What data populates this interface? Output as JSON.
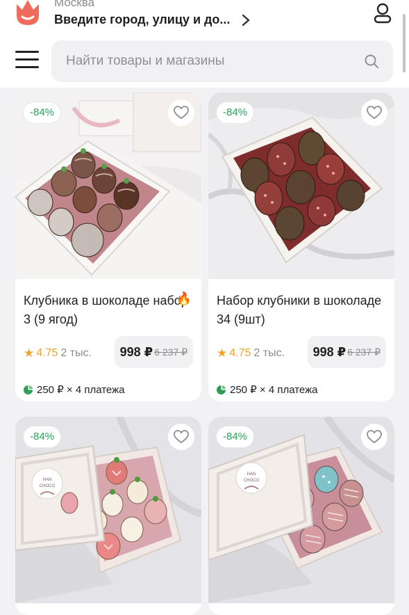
{
  "header": {
    "city": "Москва",
    "address_prompt": "Введите город, улицу и до...",
    "search_placeholder": "Найти товары и магазины"
  },
  "products": [
    {
      "discount": "-84%",
      "title": "Клубника в шоколаде набор 3 (9 ягод)",
      "hot_badge": "🔥",
      "rating": "4.75",
      "reviews": "2 тыс.",
      "price": "998 ₽",
      "old_price": "6 237 ₽",
      "installment": "250 ₽ × 4 платежа"
    },
    {
      "discount": "-84%",
      "title": "Набор клубники в шоколаде 34 (9шт)",
      "hot_badge": "",
      "rating": "4.75",
      "reviews": "2 тыс.",
      "price": "998 ₽",
      "old_price": "6 237 ₽",
      "installment": "250 ₽ × 4 платежа"
    },
    {
      "discount": "-84%",
      "box_label_1": "HAN",
      "box_label_2": "CHOCO"
    },
    {
      "discount": "-84%",
      "box_label_1": "HAN",
      "box_label_2": "CHOCO"
    }
  ],
  "colors": {
    "brand": "#f06b5b",
    "discount": "#27a45a",
    "rating": "#f0a42e",
    "installment": "#2e9e57"
  },
  "icons": [
    "tulip-logo-icon",
    "chevron-right-icon",
    "profile-icon",
    "menu-icon",
    "search-icon",
    "heart-icon",
    "fire-icon",
    "star-icon",
    "installment-icon"
  ]
}
